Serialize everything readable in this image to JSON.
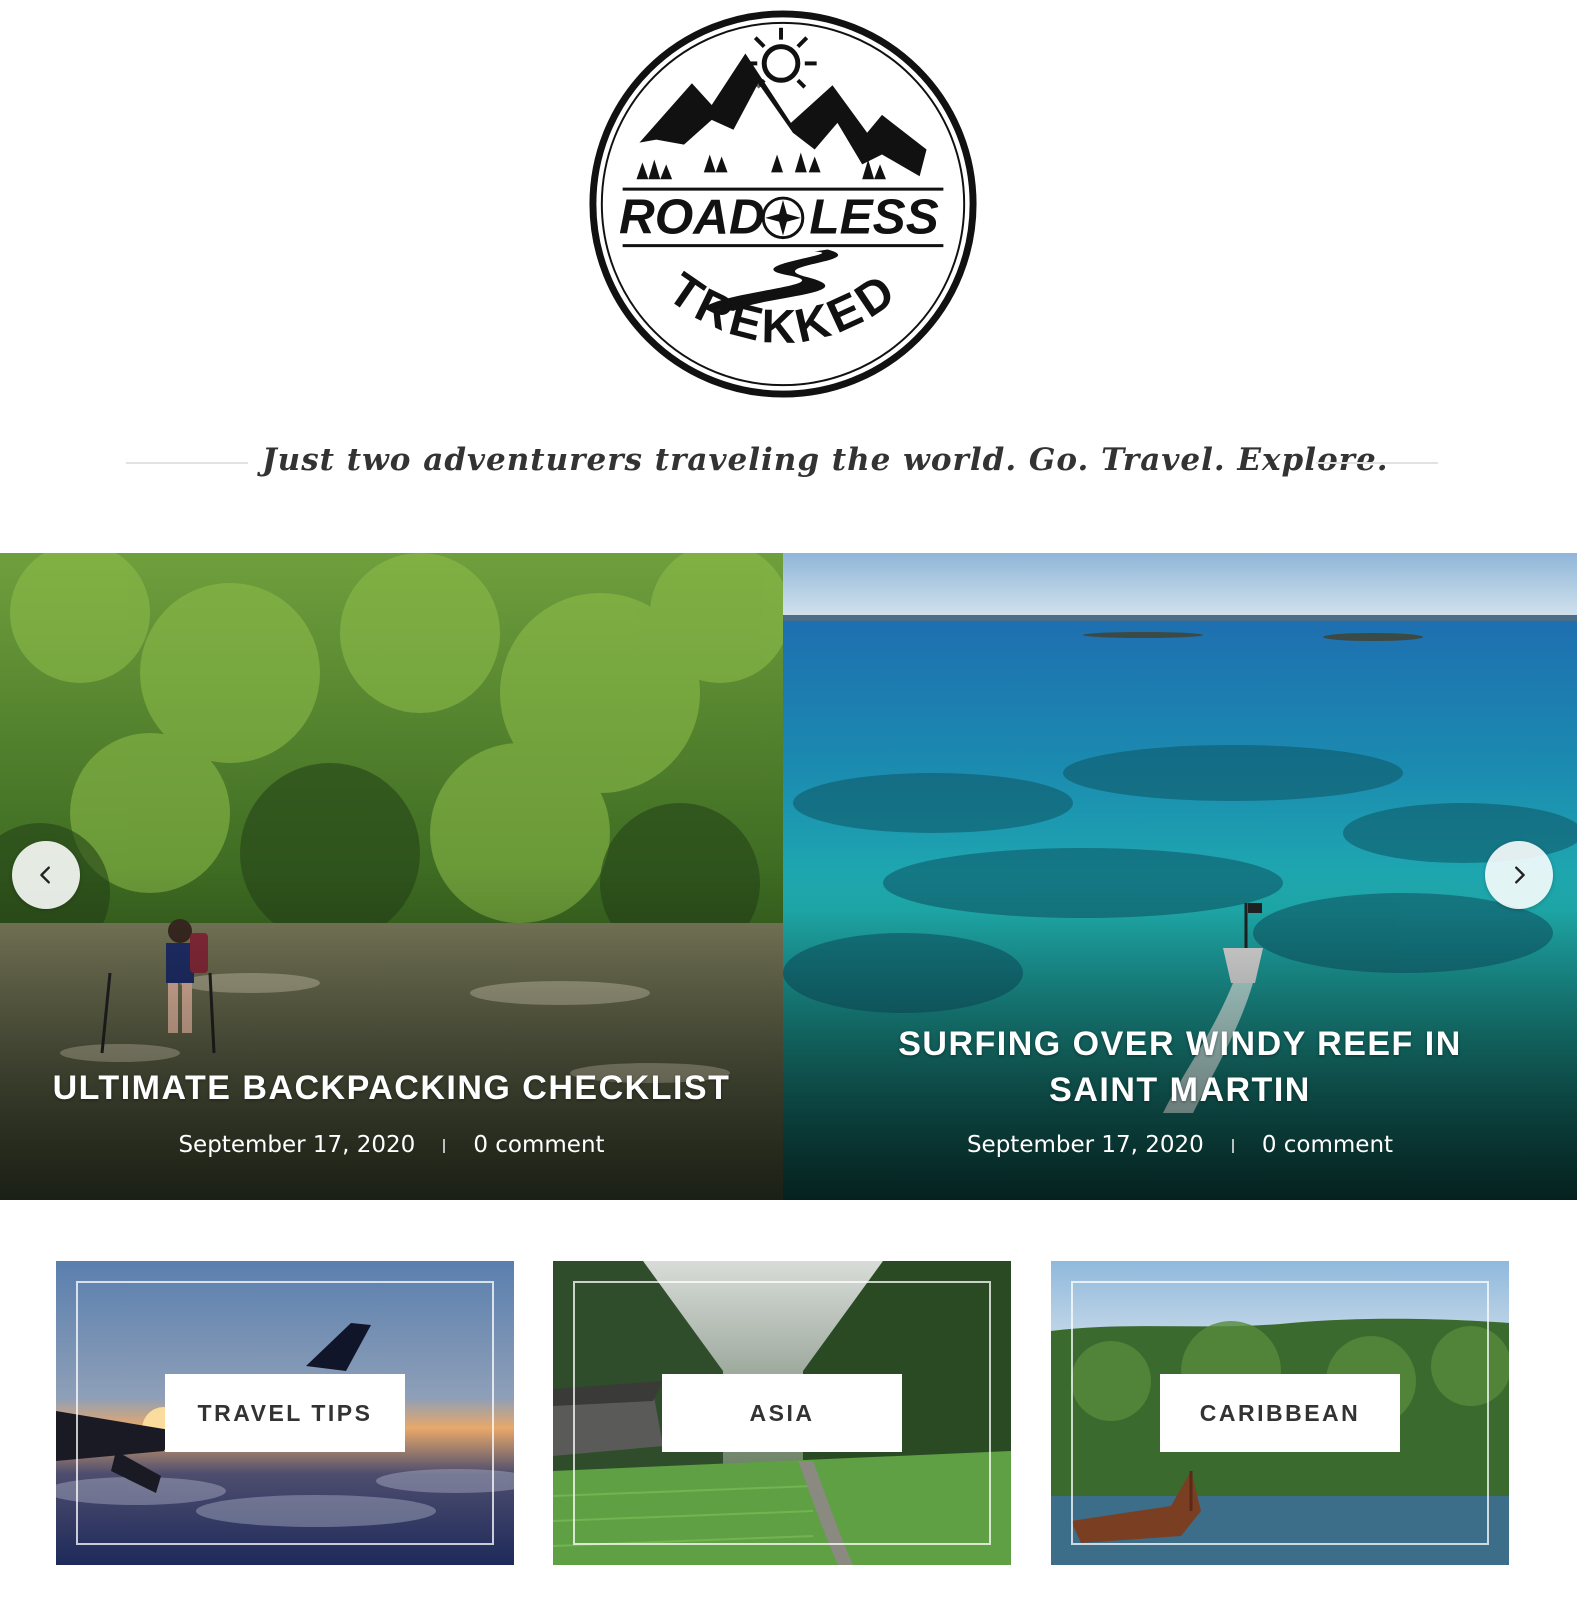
{
  "site": {
    "logo_alt": "Road Less Trekked",
    "logo_words": [
      "ROAD",
      "LESS",
      "TREKKED"
    ],
    "tagline": "Just two adventurers traveling the world. Go. Travel. Explore."
  },
  "slider": {
    "prev_icon": "chevron-left-icon",
    "next_icon": "chevron-right-icon",
    "slides": [
      {
        "title": "ULTIMATE BACKPACKING CHECKLIST",
        "date": "September 17, 2020",
        "comments": "0 comment"
      },
      {
        "title": "SURFING OVER WINDY REEF IN SAINT MARTIN",
        "date": "September 17, 2020",
        "comments": "0 comment"
      }
    ]
  },
  "categories": [
    {
      "label": "TRAVEL TIPS"
    },
    {
      "label": "ASIA"
    },
    {
      "label": "CARIBBEAN"
    }
  ],
  "colors": {
    "text_dark": "#333333",
    "divider": "#e2e2e2",
    "overlay_text": "#ffffff"
  }
}
